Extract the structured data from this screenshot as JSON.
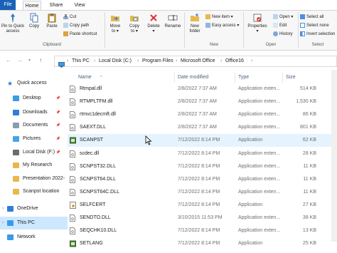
{
  "ribbon_tabs": [
    "File",
    "Home",
    "Share",
    "View"
  ],
  "ribbon": {
    "pin_quick_access": "Pin to Quick\naccess",
    "copy": "Copy",
    "paste": "Paste",
    "cut": "Cut",
    "copy_path": "Copy path",
    "paste_shortcut": "Paste shortcut",
    "clipboard_group": "Clipboard",
    "move_to": "Move\nto ▾",
    "copy_to": "Copy\nto ▾",
    "delete": "Delete\n▾",
    "rename": "Rename",
    "new_folder": "New\nfolder",
    "new_item": "New item ▾",
    "easy_access": "Easy access ▾",
    "new_group": "New",
    "properties": "Properties\n▾",
    "open": "Open ▾",
    "edit": "Edit",
    "history": "History",
    "open_group": "Open",
    "select_all": "Select all",
    "select_none": "Select none",
    "invert_selection": "Invert selection",
    "select_group": "Select"
  },
  "address": {
    "crumbs": [
      "This PC",
      "Local Disk (C:)",
      "Program Files",
      "Microsoft Office",
      "Office16"
    ]
  },
  "nav": {
    "items": [
      {
        "label": "Quick access",
        "icon": "star-icon",
        "color": "#2f7fd6",
        "pinned": false
      },
      {
        "label": "Desktop",
        "icon": "desktop-icon",
        "color": "#3a9be8",
        "pinned": true
      },
      {
        "label": "Downloads",
        "icon": "download-icon",
        "color": "#2f7fd6",
        "pinned": true
      },
      {
        "label": "Documents",
        "icon": "documents-icon",
        "color": "#8c9bb0",
        "pinned": true
      },
      {
        "label": "Pictures",
        "icon": "pictures-icon",
        "color": "#4aa3e8",
        "pinned": true
      },
      {
        "label": "Local Disk (F:)",
        "icon": "drive-icon",
        "color": "#6d6d6d",
        "pinned": true
      },
      {
        "label": "My Research",
        "icon": "folder-icon",
        "color": "#e8b84a",
        "pinned": false
      },
      {
        "label": "Presentation 2022-",
        "icon": "folder-icon",
        "color": "#e8b84a",
        "pinned": false
      },
      {
        "label": "Scanpst location",
        "icon": "folder-icon",
        "color": "#e8b84a",
        "pinned": false
      },
      {
        "label": "OneDrive",
        "icon": "cloud-icon",
        "color": "#2f7fd6",
        "pinned": false
      },
      {
        "label": "This PC",
        "icon": "computer-icon",
        "color": "#3a9be8",
        "pinned": false
      },
      {
        "label": "Network",
        "icon": "network-icon",
        "color": "#3a9be8",
        "pinned": false
      }
    ]
  },
  "columns": {
    "name": "Name",
    "date": "Date modified",
    "type": "Type",
    "size": "Size"
  },
  "files": [
    {
      "name": "Rtmpal.dll",
      "date": "2/8/2022 7:37 AM",
      "type": "Application exten...",
      "size": "514 KB",
      "icon": "dll-icon"
    },
    {
      "name": "RTMPLTFM.dll",
      "date": "2/8/2022 7:37 AM",
      "type": "Application exten...",
      "size": "1,530 KB",
      "icon": "dll-icon"
    },
    {
      "name": "rtmvc1decmft.dll",
      "date": "2/8/2022 7:37 AM",
      "type": "Application exten...",
      "size": "86 KB",
      "icon": "dll-icon"
    },
    {
      "name": "SAEXT.DLL",
      "date": "2/8/2022 7:37 AM",
      "type": "Application exten...",
      "size": "801 KB",
      "icon": "dll-icon"
    },
    {
      "name": "SCANPST",
      "date": "7/12/2022 8:14 PM",
      "type": "Application",
      "size": "62 KB",
      "icon": "exe-icon"
    },
    {
      "name": "scdec.dll",
      "date": "7/12/2022 8:14 PM",
      "type": "Application exten...",
      "size": "28 KB",
      "icon": "dll-icon"
    },
    {
      "name": "SCNPST32.DLL",
      "date": "7/12/2022 8:14 PM",
      "type": "Application exten...",
      "size": "11 KB",
      "icon": "dll-icon"
    },
    {
      "name": "SCNPST64.DLL",
      "date": "7/12/2022 8:14 PM",
      "type": "Application exten...",
      "size": "11 KB",
      "icon": "dll-icon"
    },
    {
      "name": "SCNPST64C.DLL",
      "date": "7/12/2022 8:14 PM",
      "type": "Application exten...",
      "size": "11 KB",
      "icon": "dll-icon"
    },
    {
      "name": "SELFCERT",
      "date": "7/12/2022 8:14 PM",
      "type": "Application",
      "size": "27 KB",
      "icon": "cert-icon"
    },
    {
      "name": "SENDTO.DLL",
      "date": "3/10/2015 11:53 PM",
      "type": "Application exten...",
      "size": "38 KB",
      "icon": "dll-icon"
    },
    {
      "name": "SEQCHK10.DLL",
      "date": "7/12/2022 8:14 PM",
      "type": "Application exten...",
      "size": "13 KB",
      "icon": "dll-icon"
    },
    {
      "name": "SETLANG",
      "date": "7/12/2022 8:14 PM",
      "type": "Application",
      "size": "25 KB",
      "icon": "exe-icon"
    }
  ],
  "colors": {
    "accent": "#1a62b8",
    "selected": "#cce8ff",
    "hover": "#e5f3ff"
  }
}
